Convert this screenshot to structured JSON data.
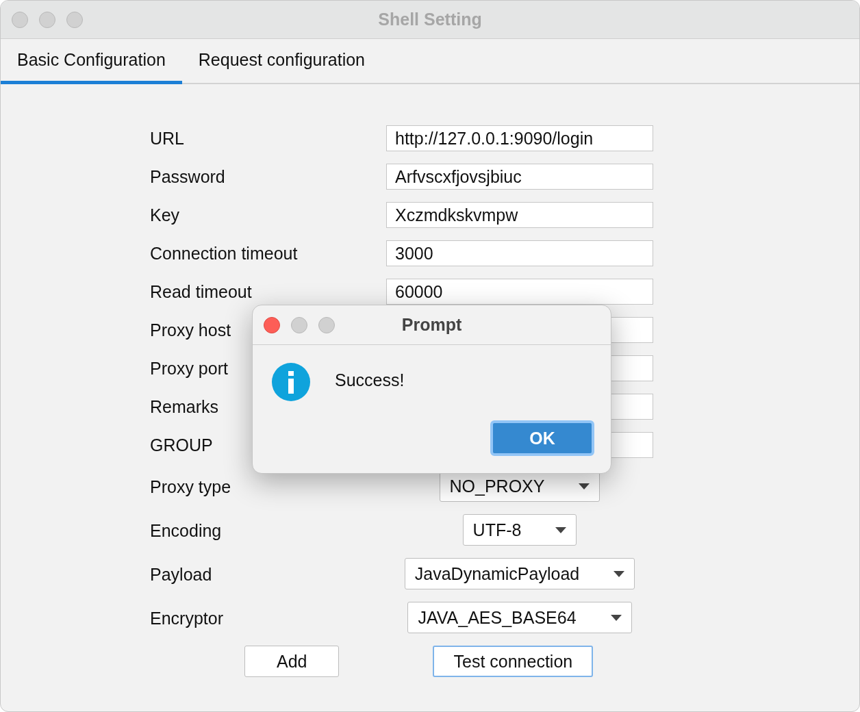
{
  "window": {
    "title": "Shell Setting"
  },
  "tabs": [
    {
      "label": "Basic Configuration",
      "selected": true
    },
    {
      "label": "Request configuration",
      "selected": false
    }
  ],
  "fields": [
    {
      "kind": "text",
      "label": "URL",
      "value": "http://127.0.0.1:9090/login"
    },
    {
      "kind": "text",
      "label": "Password",
      "value": "Arfvscxfjovsjbiuc"
    },
    {
      "kind": "text",
      "label": "Key",
      "value": "Xczmdkskvmpw"
    },
    {
      "kind": "text",
      "label": "Connection timeout",
      "value": "3000"
    },
    {
      "kind": "text",
      "label": "Read timeout",
      "value": "60000"
    },
    {
      "kind": "text",
      "label": "Proxy host"
    },
    {
      "kind": "text",
      "label": "Proxy port"
    },
    {
      "kind": "text",
      "label": "Remarks"
    },
    {
      "kind": "text",
      "label": "GROUP"
    },
    {
      "kind": "select",
      "label": "Proxy type",
      "value": "NO_PROXY"
    },
    {
      "kind": "select",
      "label": "Encoding",
      "value": "UTF-8"
    },
    {
      "kind": "select",
      "label": "Payload",
      "value": "JavaDynamicPayload"
    },
    {
      "kind": "select",
      "label": "Encryptor",
      "value": "JAVA_AES_BASE64"
    }
  ],
  "buttons": [
    {
      "label": "Add",
      "focused": false
    },
    {
      "label": "Test connection",
      "focused": true
    }
  ],
  "dialog": {
    "title": "Prompt",
    "message": "Success!",
    "button": "OK"
  }
}
